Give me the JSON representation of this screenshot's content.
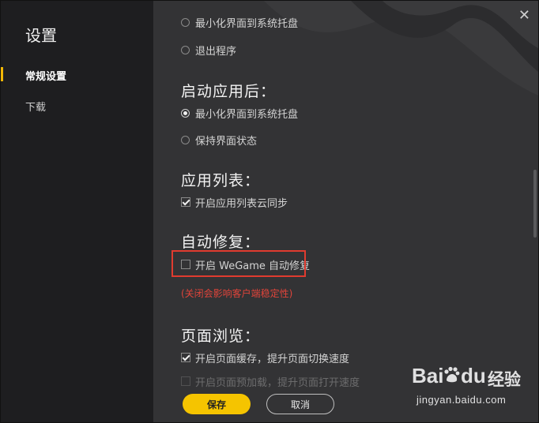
{
  "sidebar": {
    "title": "设置",
    "items": [
      {
        "label": "常规设置",
        "active": true
      },
      {
        "label": "下载",
        "active": false
      }
    ]
  },
  "close_label": "✕",
  "on_close": {
    "options": [
      {
        "label": "最小化界面到系统托盘",
        "selected": false
      },
      {
        "label": "退出程序",
        "selected": false
      }
    ]
  },
  "after_launch": {
    "title": "启动应用后：",
    "options": [
      {
        "label": "最小化界面到系统托盘",
        "selected": true
      },
      {
        "label": "保持界面状态",
        "selected": false
      }
    ]
  },
  "app_list": {
    "title": "应用列表：",
    "checkbox": {
      "label": "开启应用列表云同步",
      "checked": true
    }
  },
  "auto_repair": {
    "title": "自动修复：",
    "checkbox": {
      "label": "开启 WeGame 自动修复",
      "checked": false
    },
    "warning": "(关闭会影响客户端稳定性)"
  },
  "page_browse": {
    "title": "页面浏览：",
    "checkbox": {
      "label": "开启页面缓存，提升页面切换速度",
      "checked": true
    },
    "checkbox2": {
      "label": "开启页面预加载，提升页面打开速度",
      "checked": false
    }
  },
  "buttons": {
    "save": "保存",
    "cancel": "取消"
  },
  "watermark": {
    "brand": "Bai",
    "brand2": "du",
    "cn": "经验",
    "url": "jingyan.baidu.com"
  },
  "colors": {
    "accent": "#f5c400",
    "warning": "#e0443a",
    "highlight": "#e03b2f"
  }
}
